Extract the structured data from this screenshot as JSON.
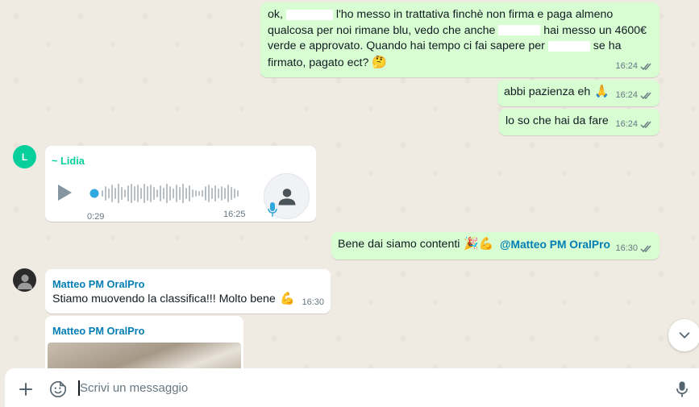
{
  "messages": {
    "m1": {
      "seg1": "ok,",
      "seg2": "l'ho messo in trattativa finchè non firma e paga almeno",
      "line2a": "qualcosa per noi rimane blu, vedo che anche",
      "line2b": "hai messo un 4600€",
      "line3": "verde e approvato. Quando hai tempo ci fai sapere per",
      "line3b": "se ha",
      "line4": "firmato, pagato ect?",
      "emoji": "🤔",
      "time": "16:24"
    },
    "m2": {
      "text": "abbi pazienza eh",
      "emoji": "🙏",
      "time": "16:24"
    },
    "m3": {
      "text": "lo so che hai da fare",
      "time": "16:24"
    },
    "voice": {
      "avatar_letter": "L",
      "sender": "~ Lidia",
      "duration": "0:29",
      "time": "16:25"
    },
    "m4": {
      "text": "Bene dai siamo contenti",
      "emoji": "🎉💪",
      "mention": "@Matteo PM OralPro",
      "time": "16:30"
    },
    "m5": {
      "sender": "Matteo PM OralPro",
      "text": "Stiamo muovendo la classifica!!! Molto bene",
      "emoji": "💪",
      "time": "16:30"
    },
    "m6": {
      "sender": "Matteo PM OralPro"
    }
  },
  "composer": {
    "placeholder": "Scrivi un messaggio"
  },
  "colors": {
    "outgoing_bubble": "#d9fdd3",
    "incoming_bubble": "#ffffff",
    "lidia_accent": "#06cf9c",
    "matteo_accent": "#027eb5",
    "read_ticks": "#667781"
  },
  "icons": [
    "double-check-icon",
    "play-icon",
    "mic-icon",
    "person-icon",
    "chevron-down-icon",
    "plus-icon",
    "sticker-icon"
  ]
}
